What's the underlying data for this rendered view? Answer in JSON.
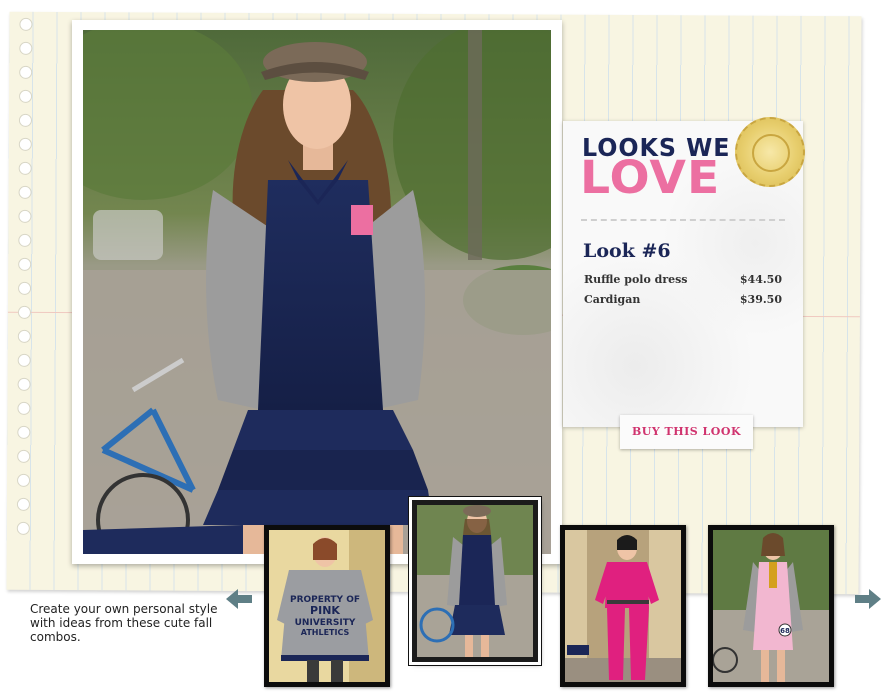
{
  "promo": {
    "title_line1": "LOOKS WE",
    "title_line2": "LOVE",
    "look_number": "Look #6",
    "items": [
      {
        "name": "Ruffle polo dress",
        "price": "$44.50"
      },
      {
        "name": "Cardigan",
        "price": "$39.50"
      }
    ],
    "buy_label": "BUY THIS LOOK"
  },
  "caption": "Create your own personal style with ideas from these cute fall combos.",
  "nav": {
    "prev_icon": "arrow-left-icon",
    "next_icon": "arrow-right-icon"
  },
  "thumbnails": [
    {
      "name": "look-hoodie-dress",
      "active": false,
      "shirt_text": "PROPERTY OF PINK UNIVERSITY ATHLETICS"
    },
    {
      "name": "look-ruffle-polo",
      "active": true
    },
    {
      "name": "look-pink-tracksuit",
      "active": false
    },
    {
      "name": "look-pink-overalls",
      "active": false,
      "badge_text": "68"
    }
  ],
  "colors": {
    "navy": "#1b2657",
    "pink": "#ec6fa1",
    "buy_text": "#d0336e",
    "paper": "#f8f5e2",
    "seal_gold": "#e8cf6f"
  }
}
